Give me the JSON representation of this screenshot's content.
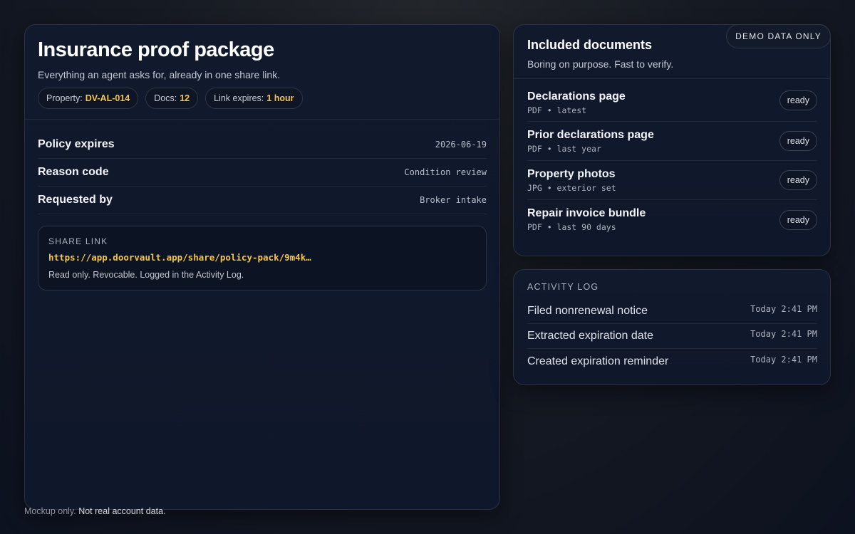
{
  "package": {
    "title": "Insurance proof package",
    "subtitle": "Everything an agent asks for, already in one share link.",
    "chips": [
      {
        "label": "Property:",
        "value": "DV-AL-014"
      },
      {
        "label": "Docs:",
        "value": "12"
      },
      {
        "label": "Link expires:",
        "value": "1 hour"
      }
    ],
    "fields": [
      {
        "label": "Policy expires",
        "value": "2026-06-19"
      },
      {
        "label": "Reason code",
        "value": "Condition review"
      },
      {
        "label": "Requested by",
        "value": "Broker intake"
      }
    ],
    "share": {
      "title": "SHARE LINK",
      "url": "https://app.doorvault.app/share/policy-pack/9m4k…",
      "note": "Read only. Revocable. Logged in the Activity Log."
    }
  },
  "documents": {
    "title": "Included documents",
    "subtitle": "Boring on purpose. Fast to verify.",
    "badge": "DEMO DATA ONLY",
    "items": [
      {
        "name": "Declarations page",
        "meta": "PDF • latest",
        "status": "ready"
      },
      {
        "name": "Prior declarations page",
        "meta": "PDF • last year",
        "status": "ready"
      },
      {
        "name": "Property photos",
        "meta": "JPG • exterior set",
        "status": "ready"
      },
      {
        "name": "Repair invoice bundle",
        "meta": "PDF • last 90 days",
        "status": "ready"
      }
    ]
  },
  "activity": {
    "title": "ACTIVITY LOG",
    "items": [
      {
        "text": "Filed nonrenewal notice",
        "time": "Today 2:41 PM"
      },
      {
        "text": "Extracted expiration date",
        "time": "Today 2:41 PM"
      },
      {
        "text": "Created expiration reminder",
        "time": "Today 2:41 PM"
      }
    ]
  },
  "footer": {
    "prefix": "Mockup only.",
    "strong": "Not real account data."
  },
  "colors": {
    "accent": "#f5c44a",
    "card_bg": "#0f172a",
    "border": "#2a3344"
  }
}
